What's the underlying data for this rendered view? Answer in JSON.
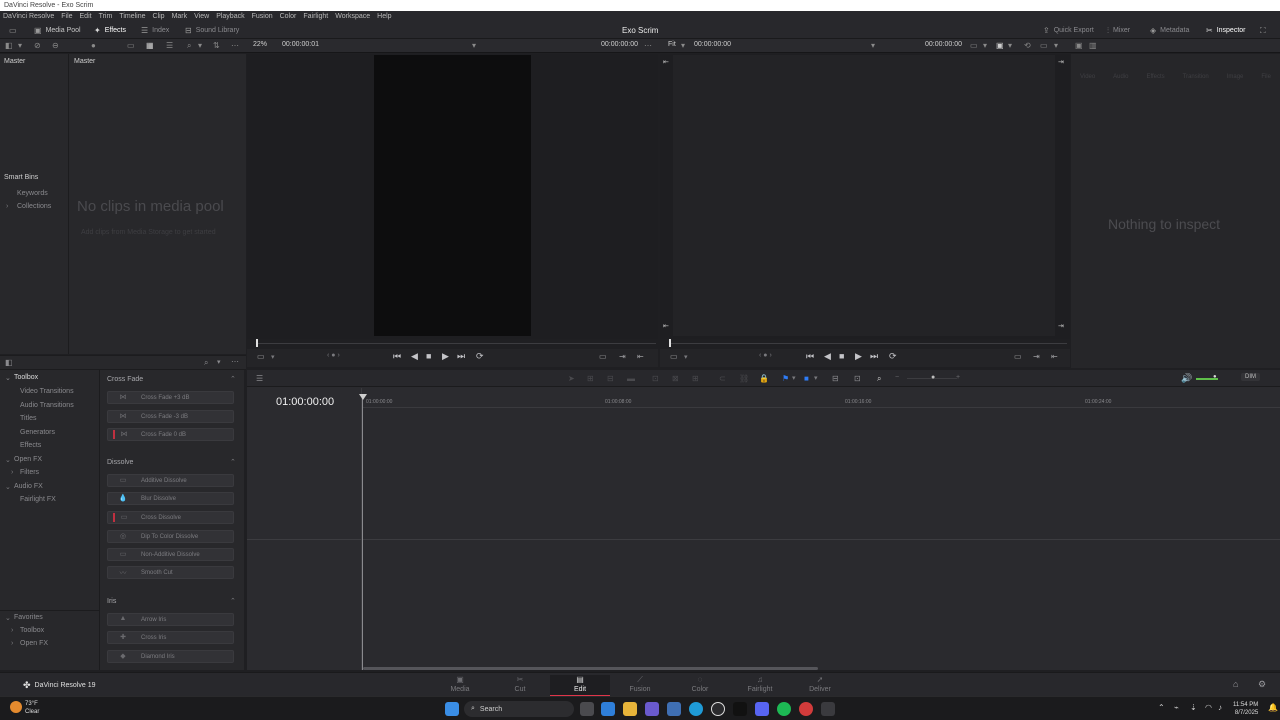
{
  "window": {
    "title": "DaVinci Resolve - Exo Scrim"
  },
  "menu": [
    "DaVinci Resolve",
    "File",
    "Edit",
    "Trim",
    "Timeline",
    "Clip",
    "Mark",
    "View",
    "Playback",
    "Fusion",
    "Color",
    "Fairlight",
    "Workspace",
    "Help"
  ],
  "toolbar": {
    "media_pool": "Media Pool",
    "effects": "Effects",
    "index": "Index",
    "sound_library": "Sound Library",
    "project_title": "Exo Scrim",
    "quick_export": "Quick Export",
    "mixer": "Mixer",
    "metadata": "Metadata",
    "inspector": "Inspector"
  },
  "source_viewer": {
    "zoom": "22%",
    "duration": "00:00:00:01",
    "timecode": "00:00:00:00"
  },
  "timeline_viewer": {
    "fit": "Fit",
    "duration": "00:00:00:00",
    "timecode": "00:00:00:00"
  },
  "media_pool": {
    "master_left": "Master",
    "master_right": "Master",
    "smart_bins": "Smart Bins",
    "keywords": "Keywords",
    "collections": "Collections",
    "empty_title": "No clips in media pool",
    "empty_sub": "Add clips from Media Storage to get started"
  },
  "inspector": {
    "tabs": [
      "Video",
      "Audio",
      "Effects",
      "Transition",
      "Image",
      "File"
    ],
    "empty": "Nothing to inspect"
  },
  "effects_tree": {
    "toolbox": "Toolbox",
    "items": [
      "Video Transitions",
      "Audio Transitions",
      "Titles",
      "Generators",
      "Effects"
    ],
    "open_fx": "Open FX",
    "filters": "Filters",
    "audio_fx": "Audio FX",
    "fairlight_fx": "Fairlight FX",
    "favorites": "Favorites",
    "fav_toolbox": "Toolbox",
    "fav_openfx": "Open FX"
  },
  "effects_list": {
    "cross_fade": "Cross Fade",
    "cf_items": [
      "Cross Fade +3 dB",
      "Cross Fade -3 dB",
      "Cross Fade 0 dB"
    ],
    "dissolve": "Dissolve",
    "dis_items": [
      "Additive Dissolve",
      "Blur Dissolve",
      "Cross Dissolve",
      "Dip To Color Dissolve",
      "Non-Additive Dissolve",
      "Smooth Cut"
    ],
    "iris": "Iris",
    "iris_items": [
      "Arrow Iris",
      "Cross Iris",
      "Diamond Iris"
    ]
  },
  "timeline": {
    "timecode": "01:00:00:00",
    "ruler": [
      "01:00:00:00",
      "01:00:08:00",
      "01:00:16:00",
      "01:00:24:00"
    ],
    "dim": "DIM"
  },
  "pages": [
    {
      "label": "Media",
      "icon": "▣"
    },
    {
      "label": "Cut",
      "icon": "✂"
    },
    {
      "label": "Edit",
      "icon": "▤"
    },
    {
      "label": "Fusion",
      "icon": "⟋"
    },
    {
      "label": "Color",
      "icon": "◌"
    },
    {
      "label": "Fairlight",
      "icon": "♫"
    },
    {
      "label": "Deliver",
      "icon": "➚"
    }
  ],
  "app_brand": "DaVinci Resolve 19",
  "taskbar": {
    "weather_temp": "73°F",
    "weather_desc": "Clear",
    "search": "Search",
    "time": "11:54 PM",
    "date": "8/7/2025"
  },
  "colors": {
    "accent_red": "#e0354a",
    "bg": "#1f1f22",
    "panel": "#28282b"
  }
}
